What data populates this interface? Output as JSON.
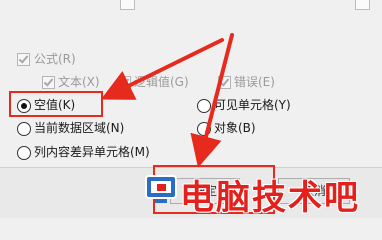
{
  "options": {
    "formulas": "公式(R)",
    "text": "文本(X)",
    "logical": "逻辑值(G)",
    "errors": "错误(E)",
    "blanks": "空值(K)",
    "visible_cells": "可见单元格(Y)",
    "current_region": "当前数据区域(N)",
    "objects": "对象(B)",
    "column_differences": "列内容差异单元格(M)"
  },
  "footer": {
    "ok_label": "确定",
    "cancel_label": "取消"
  },
  "watermark": {
    "text": "电脑技术吧"
  },
  "colors": {
    "highlight": "#e62a1e",
    "watermark": "#e3201b"
  }
}
